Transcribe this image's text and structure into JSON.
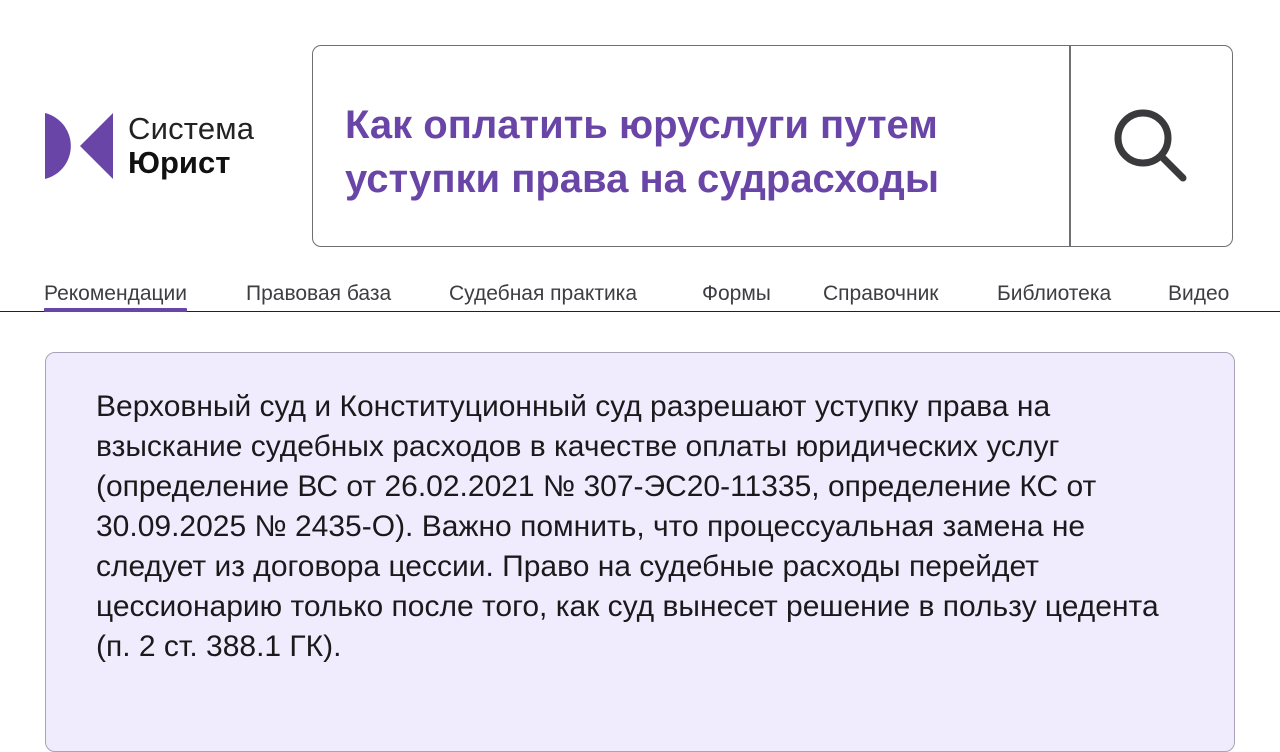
{
  "logo": {
    "line1": "Система",
    "line2": "Юрист",
    "brand_color": "#6a45a8"
  },
  "search": {
    "query": "Как оплатить юруслуги путем уступки права на судрасходы",
    "icon": "search-icon"
  },
  "nav": {
    "items": [
      {
        "label": "Рекомендации",
        "active": true
      },
      {
        "label": "Правовая база"
      },
      {
        "label": "Судебная практика"
      },
      {
        "label": "Формы"
      },
      {
        "label": "Справочник"
      },
      {
        "label": "Библиотека"
      },
      {
        "label": "Видео"
      }
    ]
  },
  "answer": {
    "text": "Верховный суд и Конституционный суд разрешают уступку права на взыскание судебных расходов в качестве оплаты юридических услуг (определение ВС от 26.02.2021 № 307-ЭС20-11335, определение КС от 30.09.2025 № 2435-О). Важно помнить, что процессуальная замена не следует из договора цессии. Право на судебные расходы перейдет цессионарию только после того, как суд вынесет решение в пользу цедента (п. 2 ст. 388.1 ГК).",
    "background": "#f1ecfd"
  }
}
